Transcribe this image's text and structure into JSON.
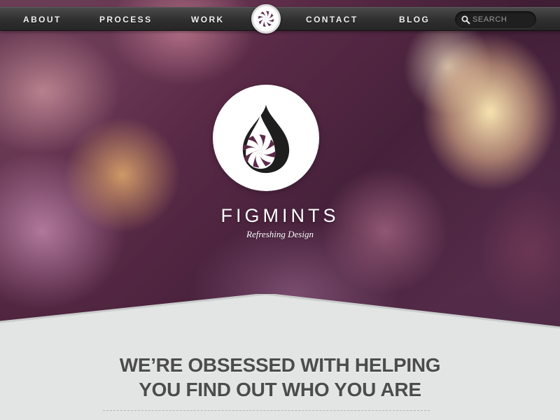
{
  "nav": {
    "items": [
      {
        "label": "ABOUT"
      },
      {
        "label": "PROCESS"
      },
      {
        "label": "WORK"
      },
      {
        "label": "CONTACT"
      },
      {
        "label": "BLOG"
      }
    ],
    "search_placeholder": "SEARCH"
  },
  "brand": {
    "name": "FIGMINTS",
    "tagline": "Refreshing Design",
    "colors": {
      "accent": "#5b2a4a",
      "dark": "#1e1e1e"
    }
  },
  "hero": {
    "headline_line1": "WE’RE OBSESSED WITH HELPING",
    "headline_line2": "YOU FIND OUT WHO YOU ARE"
  },
  "icons": [
    "search-icon",
    "figmints-logo-icon"
  ]
}
